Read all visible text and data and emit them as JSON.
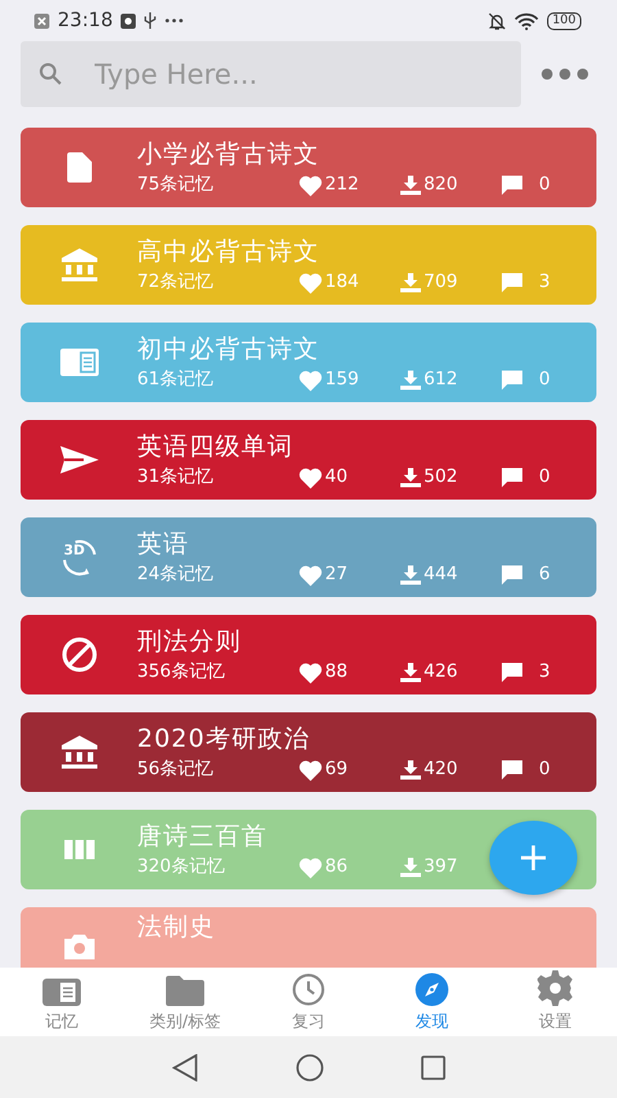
{
  "status_bar": {
    "time": "23:18",
    "battery": "100"
  },
  "search": {
    "placeholder": "Type Here..."
  },
  "cards": [
    {
      "title": "小学必背古诗文",
      "subtitle": "75条记忆",
      "likes": "212",
      "downloads": "820",
      "comments": "0",
      "color": "#d05252"
    },
    {
      "title": "高中必背古诗文",
      "subtitle": "72条记忆",
      "likes": "184",
      "downloads": "709",
      "comments": "3",
      "color": "#e6bb21"
    },
    {
      "title": "初中必背古诗文",
      "subtitle": "61条记忆",
      "likes": "159",
      "downloads": "612",
      "comments": "0",
      "color": "#5fbcdc"
    },
    {
      "title": "英语四级单词",
      "subtitle": "31条记忆",
      "likes": "40",
      "downloads": "502",
      "comments": "0",
      "color": "#cc1c30"
    },
    {
      "title": "英语",
      "subtitle": "24条记忆",
      "likes": "27",
      "downloads": "444",
      "comments": "6",
      "color": "#6aa3c0",
      "icon_label": "3D"
    },
    {
      "title": "刑法分则",
      "subtitle": "356条记忆",
      "likes": "88",
      "downloads": "426",
      "comments": "3",
      "color": "#cc1c30"
    },
    {
      "title": "2020考研政治",
      "subtitle": "56条记忆",
      "likes": "69",
      "downloads": "420",
      "comments": "0",
      "color": "#9c2a35"
    },
    {
      "title": "唐诗三百首",
      "subtitle": "320条记忆",
      "likes": "86",
      "downloads": "397",
      "color": "#98d091"
    },
    {
      "title": "法制史",
      "color": "#f3a89d"
    }
  ],
  "tabs": [
    {
      "label": "记忆",
      "selected": false
    },
    {
      "label": "类别/标签",
      "selected": false
    },
    {
      "label": "复习",
      "selected": false
    },
    {
      "label": "发现",
      "selected": true
    },
    {
      "label": "设置",
      "selected": false
    }
  ]
}
